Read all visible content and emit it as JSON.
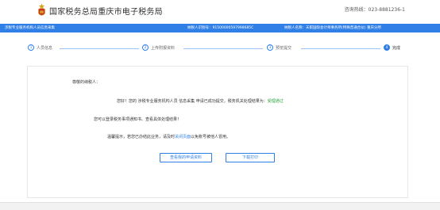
{
  "header": {
    "site_title": "国家税务总局重庆市电子税务局",
    "hotline": "咨询热线：023-8881236-1"
  },
  "infobar": {
    "title": "涉税专业服务机构人员信息采集",
    "tax_id": "纳税人识别号：91500000597998685C",
    "tax_name": "纳税人名称：天职国际会计师事务所(特殊普通合伙)  重庆分所"
  },
  "steps": [
    {
      "num": "1",
      "label": "人员信息"
    },
    {
      "num": "2",
      "label": "上传附报资料"
    },
    {
      "num": "3",
      "label": "预览提交"
    },
    {
      "num": "4",
      "label": "完成"
    }
  ],
  "panel": {
    "greeting": "尊敬的纳税人：",
    "message_prefix": "您好！您的 涉税专业服务机构人员 信息采集 申请已成功提交，税务机关处理结果为：",
    "message_result": "受理通过",
    "message_2": "您可以登录税务事项通知书、查看具体处理结果！",
    "message_3_prefix": "温馨提示，若您已办结此业务，请及时",
    "message_3_link": "关闭页面",
    "message_3_suffix": "以免账号被他人冒用。",
    "button_view": "查看我的申请资料",
    "button_print": "下载打印"
  },
  "colors": {
    "accent": "#2f7fe6",
    "success": "#2aa33e"
  }
}
